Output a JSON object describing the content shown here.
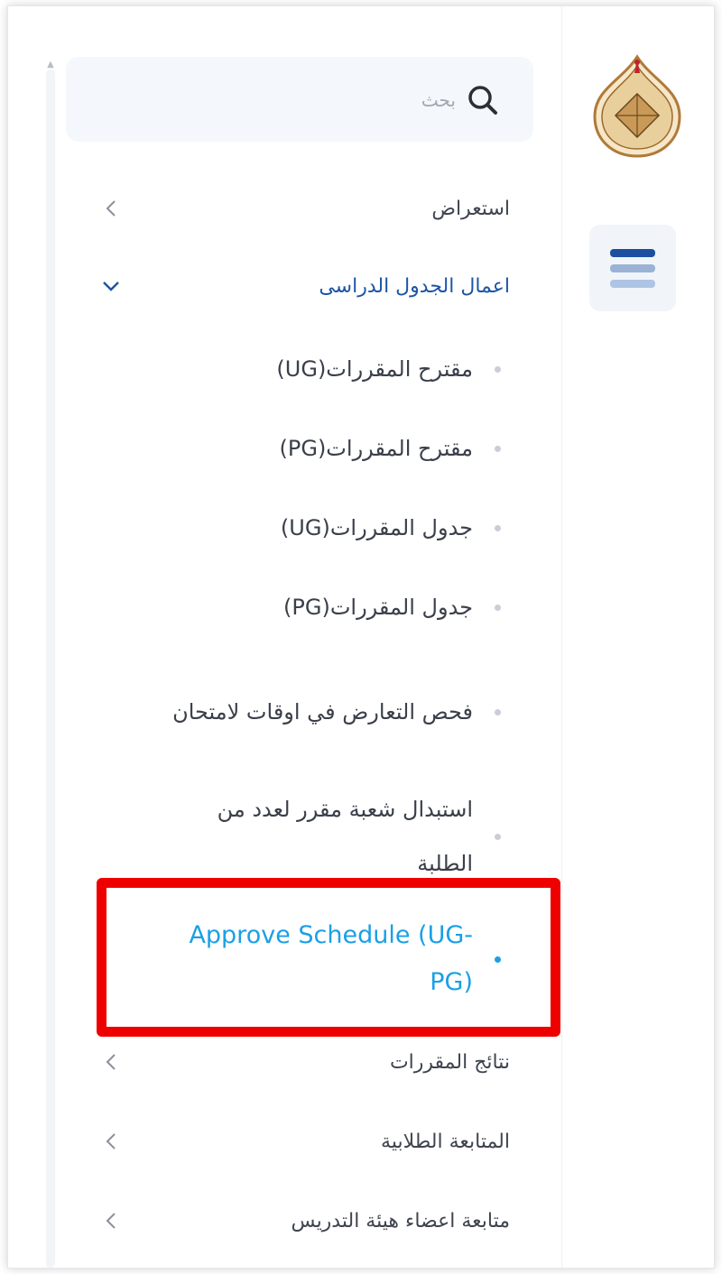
{
  "search": {
    "placeholder": "بحث",
    "value": ""
  },
  "logo": {
    "name": "university-seal"
  },
  "nav": {
    "items": [
      {
        "label": "استعراض",
        "expanded": false
      },
      {
        "label": "اعمال الجدول الدراسى",
        "expanded": true,
        "children": [
          "مقترح المقررات(UG)",
          "مقترح المقررات(PG)",
          "جدول المقررات(UG)",
          "جدول المقررات(PG)",
          "فحص التعارض في اوقات لامتحان",
          "استبدال شعبة مقرر لعدد من الطلبة",
          "Approve Schedule (UG-PG)"
        ],
        "selected_child": "Approve Schedule (UG-PG)"
      },
      {
        "label": "نتائج المقررات",
        "expanded": false
      },
      {
        "label": "المتابعة الطلابية",
        "expanded": false
      },
      {
        "label": "متابعة اعضاء هيئة التدريس",
        "expanded": false
      }
    ]
  },
  "colors": {
    "active_group": "#1d55a5",
    "selected_item": "#1aa0e6",
    "highlight_border": "#ee0000"
  }
}
